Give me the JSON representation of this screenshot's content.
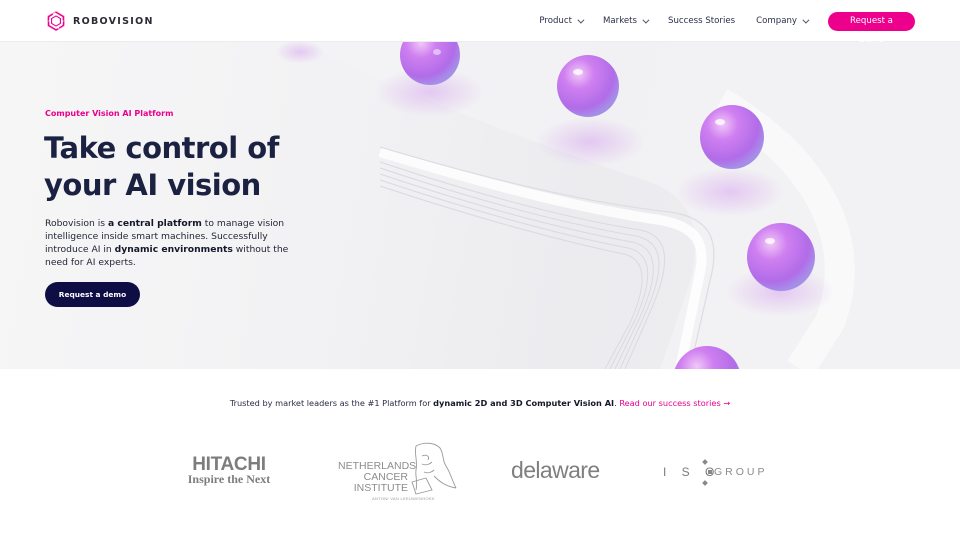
{
  "brand": {
    "name": "ROBOVISION",
    "accent_color": "#ec008c",
    "dark_color": "#0e0e45",
    "logo_icon": "hexagon-swirl-icon"
  },
  "nav": {
    "items": [
      {
        "label": "Product",
        "has_dropdown": true
      },
      {
        "label": "Markets",
        "has_dropdown": true
      },
      {
        "label": "Success Stories",
        "has_dropdown": false
      },
      {
        "label": "Company",
        "has_dropdown": true
      }
    ],
    "cta_label": "Request a Demo"
  },
  "hero": {
    "eyebrow": "Computer Vision AI Platform",
    "title_line1": "Take control of",
    "title_line2": "your AI vision",
    "desc": {
      "p1": "Robovision is ",
      "b1": "a central platform",
      "p2": " to manage vision intelligence inside smart machines. Successfully introduce AI in ",
      "b2": "dynamic environments",
      "p3": " without the need for AI experts."
    },
    "cta_label": "Request a demo",
    "art": "purple-spheres-on-curved-track"
  },
  "trust": {
    "p1": "Trusted by market leaders as the #1 Platform for ",
    "bold": "dynamic 2D and 3D Computer Vision AI",
    "p2": ". ",
    "link": "Read our success stories →"
  },
  "clients": {
    "hitachi": {
      "name": "HITACHI",
      "tagline": "Inspire the Next"
    },
    "nki": {
      "line1": "NETHERLANDS",
      "line2": "CANCER",
      "line3": "INSTITUTE",
      "sub": "ANTONI VAN LEEUWENHOEK"
    },
    "delaware": {
      "name": "delaware"
    },
    "isogroup": {
      "left": "I S O",
      "right": "GROUP"
    }
  }
}
